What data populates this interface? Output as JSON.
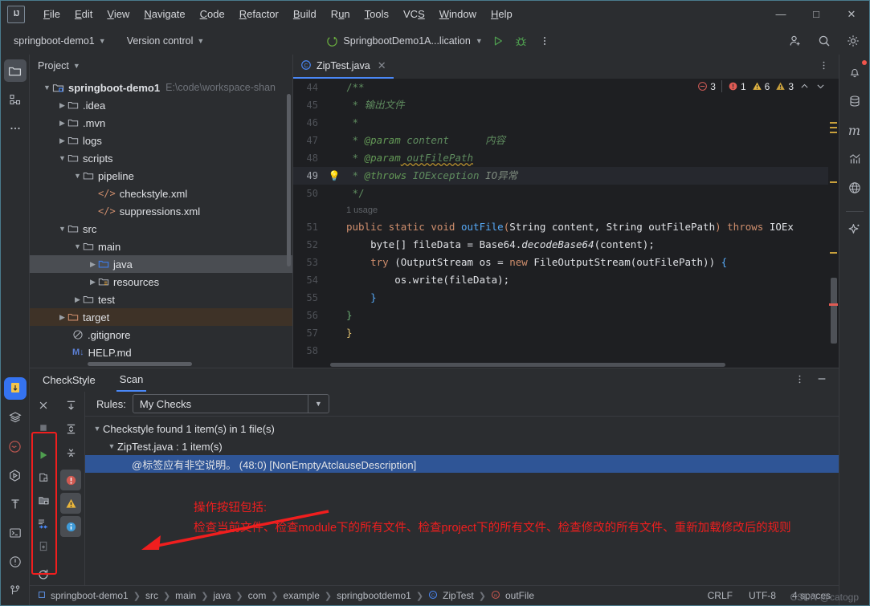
{
  "titlebar": {
    "logo": "IJ",
    "menus": [
      "File",
      "Edit",
      "View",
      "Navigate",
      "Code",
      "Refactor",
      "Build",
      "Run",
      "Tools",
      "VCS",
      "Window",
      "Help"
    ],
    "window_controls": {
      "minimize": "—",
      "maximize": "□",
      "close": "✕"
    }
  },
  "toolbar": {
    "project_chip": "springboot-demo1",
    "vcs_chip": "Version control",
    "run_config": "SpringbootDemo1A...lication",
    "run_label": "Run",
    "debug_label": "Debug",
    "more_label": "More",
    "share_label": "Share project",
    "search_label": "Search everywhere",
    "settings_label": "Settings"
  },
  "left_rail": [
    {
      "name": "project-tool-window",
      "icon": "folder-icon",
      "selected": true
    },
    {
      "name": "structure-tool-window",
      "icon": "structure-icon",
      "selected": false
    },
    {
      "name": "more-tool-windows",
      "icon": "ellipsis-icon",
      "selected": false
    }
  ],
  "left_rail_bottom": [
    {
      "name": "checkstyle-tool-window",
      "icon": "checkstyle-icon",
      "selected": true
    },
    {
      "name": "services-tool-window",
      "icon": "layers-icon",
      "selected": false
    },
    {
      "name": "problems-tool-window",
      "icon": "problems-icon",
      "selected": false
    },
    {
      "name": "run-tool-window",
      "icon": "run-circle-icon",
      "selected": false
    },
    {
      "name": "build-tool-window",
      "icon": "hammer-icon",
      "selected": false
    },
    {
      "name": "terminal-tool-window",
      "icon": "terminal-icon",
      "selected": false
    },
    {
      "name": "notifications-tool-window",
      "icon": "exclamation-circle-icon",
      "selected": false
    },
    {
      "name": "git-tool-window",
      "icon": "git-branch-icon",
      "selected": false
    }
  ],
  "right_rail": [
    {
      "name": "notifications",
      "icon": "bell-icon",
      "badge": true
    },
    {
      "name": "database",
      "icon": "database-icon",
      "badge": false
    },
    {
      "name": "maven",
      "icon": "maven-m-icon",
      "badge": false
    },
    {
      "name": "profiler",
      "icon": "chart-icon",
      "badge": false
    },
    {
      "name": "web",
      "icon": "globe-icon",
      "badge": false
    },
    {
      "name": "ai-assistant",
      "icon": "sparkle-icon",
      "badge": false
    }
  ],
  "project_panel": {
    "title": "Project",
    "tree": [
      {
        "depth": 0,
        "arrow": "down",
        "icon": "module-icon",
        "label": "springboot-demo1",
        "bold": true,
        "path": "E:\\code\\workspace-shan"
      },
      {
        "depth": 1,
        "arrow": "right",
        "icon": "folder-icon",
        "label": ".idea"
      },
      {
        "depth": 1,
        "arrow": "right",
        "icon": "folder-icon",
        "label": ".mvn"
      },
      {
        "depth": 1,
        "arrow": "right",
        "icon": "folder-icon",
        "label": "logs"
      },
      {
        "depth": 1,
        "arrow": "down",
        "icon": "folder-icon",
        "label": "scripts"
      },
      {
        "depth": 2,
        "arrow": "down",
        "icon": "folder-icon",
        "label": "pipeline"
      },
      {
        "depth": 3,
        "arrow": "none",
        "icon": "xml-icon",
        "label": "checkstyle.xml"
      },
      {
        "depth": 3,
        "arrow": "none",
        "icon": "xml-icon",
        "label": "suppressions.xml"
      },
      {
        "depth": 1,
        "arrow": "down",
        "icon": "folder-icon",
        "label": "src"
      },
      {
        "depth": 2,
        "arrow": "down",
        "icon": "folder-icon",
        "label": "main"
      },
      {
        "depth": 3,
        "arrow": "right",
        "icon": "source-folder-icon",
        "label": "java",
        "selected": true
      },
      {
        "depth": 3,
        "arrow": "right",
        "icon": "resource-folder-icon",
        "label": "resources"
      },
      {
        "depth": 2,
        "arrow": "right",
        "icon": "folder-icon",
        "label": "test"
      },
      {
        "depth": 1,
        "arrow": "right",
        "icon": "excluded-folder-icon",
        "label": "target",
        "target": true
      },
      {
        "depth": 1,
        "arrow": "none",
        "icon": "gitignore-icon",
        "label": ".gitignore"
      },
      {
        "depth": 1,
        "arrow": "none",
        "icon": "markdown-icon",
        "label": "HELP.md"
      }
    ]
  },
  "editor": {
    "tab": {
      "label": "ZipTest.java",
      "icon": "java-class-icon",
      "close": "✕"
    },
    "options_label": "Editor options",
    "inspections": {
      "deprecated_count": "3",
      "error_count": "1",
      "warning_count": "6",
      "weak_warning_count": "3",
      "prev_label": "Previous highlighted error",
      "next_label": "Next highlighted error"
    },
    "usage_hint": "1 usage",
    "lines": [
      {
        "no": "44",
        "text": "    /**"
      },
      {
        "no": "45",
        "text": "     * 输出文件"
      },
      {
        "no": "46",
        "text": "     *"
      },
      {
        "no": "47",
        "text": "     * @param content      内容"
      },
      {
        "no": "48",
        "text": "     * @param outFilePath "
      },
      {
        "no": "49",
        "text": "     * @throws IOException IO异常"
      },
      {
        "no": "50",
        "text": "     */"
      },
      {
        "no": "51",
        "text": "    public static void outFile(String content, String outFilePath) throws IOEx"
      },
      {
        "no": "52",
        "text": "        byte[] fileData = Base64.decodeBase64(content);"
      },
      {
        "no": "53",
        "text": "        try (OutputStream os = new FileOutputStream(outFilePath)) {"
      },
      {
        "no": "54",
        "text": "            os.write(fileData);"
      },
      {
        "no": "55",
        "text": "        }"
      },
      {
        "no": "56",
        "text": "    }"
      },
      {
        "no": "57",
        "text": "}"
      },
      {
        "no": "58",
        "text": ""
      }
    ]
  },
  "checkstyle": {
    "tab_main": "CheckStyle",
    "tab_scan": "Scan",
    "more_label": "Options",
    "hide_label": "Hide",
    "rules_label": "Rules:",
    "rules_value": "My Checks",
    "tools": {
      "close": "Close",
      "stop": "Stop",
      "run_current": "Check Current File",
      "run_module": "Check Module",
      "run_project": "Check Project",
      "run_modified": "Check All Modified Files",
      "add_to_scan": "Scan files",
      "reload": "Reload rules",
      "expand": "Expand All",
      "collapse": "Collapse All",
      "scroll": "Scroll to Source",
      "filter_error": "Show Errors",
      "filter_warning": "Show Warnings",
      "filter_info": "Show Info"
    },
    "results": [
      {
        "depth": 0,
        "arrow": "down",
        "text": "Checkstyle found 1 item(s) in 1 file(s)"
      },
      {
        "depth": 1,
        "arrow": "down",
        "text": "ZipTest.java : 1 item(s)"
      },
      {
        "depth": 2,
        "arrow": "none",
        "text": "@标签应有非空说明。 (48:0) [NonEmptyAtclauseDescription]",
        "selected": true
      }
    ]
  },
  "annotation": {
    "line1": "操作按钮包括:",
    "line2": "检查当前文件、检查module下的所有文件、检查project下的所有文件、检查修改的所有文件、重新加载修改后的规则",
    "color": "#f01e1e"
  },
  "status_bar": {
    "breadcrumbs": [
      {
        "icon": "module-icon",
        "label": "springboot-demo1"
      },
      {
        "icon": "none",
        "label": "src"
      },
      {
        "icon": "none",
        "label": "main"
      },
      {
        "icon": "none",
        "label": "java"
      },
      {
        "icon": "none",
        "label": "com"
      },
      {
        "icon": "none",
        "label": "example"
      },
      {
        "icon": "none",
        "label": "springbootdemo1"
      },
      {
        "icon": "java-class-icon",
        "label": "ZipTest"
      },
      {
        "icon": "method-icon",
        "label": "outFile"
      }
    ],
    "line_separator": "CRLF",
    "encoding": "UTF-8",
    "indent": "4 spaces",
    "watermark": "CSDN @catogp"
  },
  "colors": {
    "accent_blue": "#4a88f7",
    "selection_blue": "#2f5596",
    "annotation_red": "#f01e1e",
    "window_bg": "#2b2d30",
    "editor_bg": "#1e1f22",
    "target_row": "#3e3227"
  }
}
